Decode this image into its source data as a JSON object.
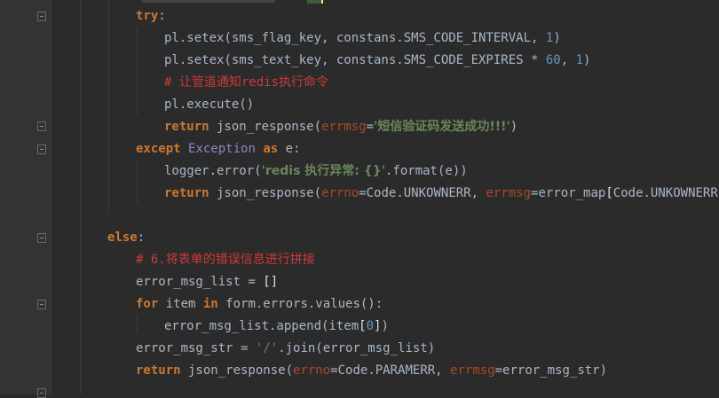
{
  "editor": {
    "lines": [
      {
        "id": "l1",
        "tokens": [
          [
            "kw",
            "try"
          ],
          [
            "op",
            ":"
          ]
        ]
      },
      {
        "id": "l2",
        "tokens": [
          [
            "id",
            "pl.setex(sms_flag_key, constans.SMS_CODE_INTERVAL, "
          ],
          [
            "num",
            "1"
          ],
          [
            "id",
            ")"
          ]
        ]
      },
      {
        "id": "l3",
        "tokens": [
          [
            "id",
            "pl.setex(sms_text_key, constans.SMS_CODE_EXPIRES * "
          ],
          [
            "num",
            "60"
          ],
          [
            "id",
            ", "
          ],
          [
            "num",
            "1"
          ],
          [
            "id",
            ")"
          ]
        ]
      },
      {
        "id": "l4",
        "tokens": [
          [
            "cmt",
            "# 让管道通知redis执行命令"
          ]
        ]
      },
      {
        "id": "l5",
        "tokens": [
          [
            "id",
            "pl.execute()"
          ]
        ]
      },
      {
        "id": "l6",
        "tokens": [
          [
            "kw",
            "return"
          ],
          [
            "id",
            " json_response("
          ],
          [
            "param",
            "errmsg"
          ],
          [
            "id",
            "="
          ],
          [
            "str",
            "'短信验证码发送成功!!!'"
          ],
          [
            "id",
            ")"
          ]
        ]
      },
      {
        "id": "l7",
        "tokens": [
          [
            "kw",
            "except"
          ],
          [
            "id",
            " "
          ],
          [
            "cls",
            "Exception"
          ],
          [
            "id",
            " "
          ],
          [
            "kw",
            "as"
          ],
          [
            "id",
            " e:"
          ]
        ]
      },
      {
        "id": "l8",
        "tokens": [
          [
            "id",
            "logger.error("
          ],
          [
            "str",
            "'redis 执行异常: {}'"
          ],
          [
            "id",
            ".format(e))"
          ]
        ]
      },
      {
        "id": "l9",
        "tokens": [
          [
            "kw",
            "return"
          ],
          [
            "id",
            " json_response("
          ],
          [
            "param",
            "errno"
          ],
          [
            "id",
            "=Code.UNKOWNERR, "
          ],
          [
            "param",
            "errmsg"
          ],
          [
            "id",
            "=error_map"
          ],
          [
            "br",
            "["
          ],
          [
            "id",
            "Code.UNKOWNERR"
          ],
          [
            "br",
            "]"
          ],
          [
            "id",
            ")"
          ]
        ]
      },
      {
        "id": "l10",
        "tokens": []
      },
      {
        "id": "l11",
        "tokens": [
          [
            "kw",
            "else"
          ],
          [
            "id",
            ":"
          ]
        ]
      },
      {
        "id": "l12",
        "tokens": [
          [
            "cmt",
            "# 6.将表单的错误信息进行拼接"
          ]
        ]
      },
      {
        "id": "l13",
        "tokens": [
          [
            "id",
            "error_msg_list = "
          ],
          [
            "br",
            "[]"
          ]
        ]
      },
      {
        "id": "l14",
        "tokens": [
          [
            "kw",
            "for"
          ],
          [
            "id",
            " item "
          ],
          [
            "kw",
            "in"
          ],
          [
            "id",
            " form.errors.values():"
          ]
        ]
      },
      {
        "id": "l15",
        "tokens": [
          [
            "id",
            "error_msg_list.append(item"
          ],
          [
            "br",
            "["
          ],
          [
            "num",
            "0"
          ],
          [
            "br",
            "]"
          ],
          [
            "id",
            ")"
          ]
        ]
      },
      {
        "id": "l16",
        "tokens": [
          [
            "id",
            "error_msg_str = "
          ],
          [
            "str",
            "'/'"
          ],
          [
            "id",
            ".join(error_msg_list)"
          ]
        ]
      },
      {
        "id": "l17",
        "tokens": [
          [
            "kw",
            "return"
          ],
          [
            "id",
            " json_response("
          ],
          [
            "param",
            "errno"
          ],
          [
            "id",
            "=Code.PARAMERR, "
          ],
          [
            "param",
            "errmsg"
          ],
          [
            "id",
            "=error_msg_str)"
          ]
        ]
      }
    ]
  }
}
